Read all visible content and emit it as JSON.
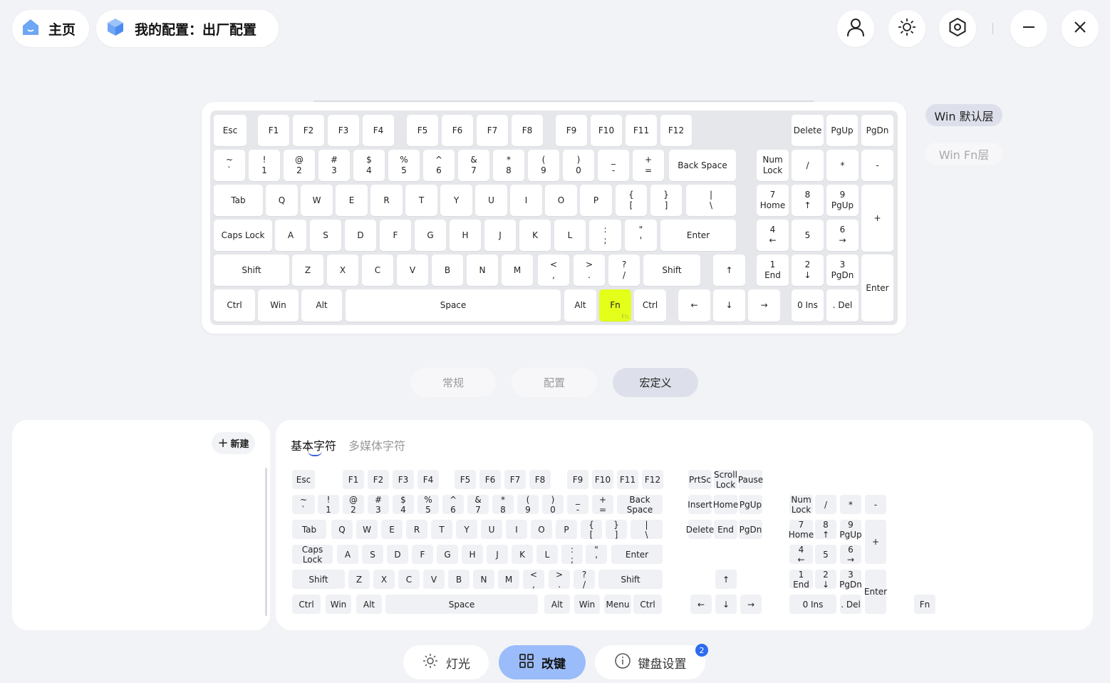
{
  "header": {
    "home_label": "主页",
    "config_label": "我的配置：出厂配置",
    "icons": [
      "user-icon",
      "sun-icon",
      "settings-hex-icon",
      "minimize-icon",
      "close-icon"
    ]
  },
  "layers": {
    "win_default": "Win 默认层",
    "win_fn": "Win Fn层"
  },
  "main_keyboard": {
    "fn_sublabel": "Fn",
    "rows": [
      [
        "Esc",
        "F1",
        "F2",
        "F3",
        "F4",
        "F5",
        "F6",
        "F7",
        "F8",
        "F9",
        "F10",
        "F11",
        "F12",
        "Delete",
        "PgUp",
        "PgDn"
      ],
      [
        "~|`",
        "!|1",
        "@|2",
        "#|3",
        "$|4",
        "%|5",
        "^|6",
        "&|7",
        "*|8",
        "(|9",
        ")|0",
        "_|-",
        "+|=",
        "Back Space",
        "Num|Lock",
        "/",
        "*",
        "-"
      ],
      [
        "Tab",
        "Q",
        "W",
        "E",
        "R",
        "T",
        "Y",
        "U",
        "I",
        "O",
        "P",
        "{|[",
        "}|]",
        "||\\",
        "7|Home",
        "8|↑",
        "9|PgUp",
        "+"
      ],
      [
        "Caps Lock",
        "A",
        "S",
        "D",
        "F",
        "G",
        "H",
        "J",
        "K",
        "L",
        ":|;",
        "\"|'",
        "Enter",
        "4|←",
        "5",
        "6|→"
      ],
      [
        "Shift",
        "Z",
        "X",
        "C",
        "V",
        "B",
        "N",
        "M",
        "<|,",
        ">|.",
        "?|/",
        "Shift",
        "↑",
        "1|End",
        "2|↓",
        "3|PgDn",
        "Enter"
      ],
      [
        "Ctrl",
        "Win",
        "Alt",
        "Space",
        "Alt",
        "Fn",
        "Ctrl",
        "←",
        "↓",
        "→",
        "0 Ins",
        ". Del"
      ]
    ]
  },
  "tabs": [
    "常规",
    "配置",
    "宏定义"
  ],
  "macro_panel": {
    "new_label": "新建"
  },
  "char_tabs": {
    "basic": "基本字符",
    "media": "多媒体字符"
  },
  "select_keyboard": {
    "rows": [
      [
        "Esc",
        "F1",
        "F2",
        "F3",
        "F4",
        "F5",
        "F6",
        "F7",
        "F8",
        "F9",
        "F10",
        "F11",
        "F12",
        "PrtSc",
        "Scroll|Lock",
        "Pause"
      ],
      [
        "~|`",
        "!|1",
        "@|2",
        "#|3",
        "$|4",
        "%|5",
        "^|6",
        "&|7",
        "*|8",
        "(|9",
        ")|0",
        "_|-",
        "+|=",
        "Back Space",
        "Insert",
        "Home",
        "PgUp",
        "Num|Lock",
        "/",
        "*",
        "-"
      ],
      [
        "Tab",
        "Q",
        "W",
        "E",
        "R",
        "T",
        "Y",
        "U",
        "I",
        "O",
        "P",
        "{|[",
        "}|]",
        "||\\",
        "Delete",
        "End",
        "PgDn",
        "7|Home",
        "8|↑",
        "9|PgUp",
        "+"
      ],
      [
        "Caps Lock",
        "A",
        "S",
        "D",
        "F",
        "G",
        "H",
        "J",
        "K",
        "L",
        ":|;",
        "\"|'",
        "Enter",
        "4|←",
        "5",
        "6|→"
      ],
      [
        "Shift",
        "Z",
        "X",
        "C",
        "V",
        "B",
        "N",
        "M",
        "<|,",
        ">|.",
        "?|/",
        "Shift",
        "↑",
        "1|End",
        "2|↓",
        "3|PgDn",
        "Enter"
      ],
      [
        "Ctrl",
        "Win",
        "Alt",
        "Space",
        "Alt",
        "Win",
        "Menu",
        "Ctrl",
        "←",
        "↓",
        "→",
        "0 Ins",
        ". Del",
        "Fn"
      ]
    ]
  },
  "bottom_nav": {
    "light": "灯光",
    "remap": "改键",
    "settings": "键盘设置",
    "badge": "2"
  },
  "colors": {
    "accent": "#9bbcfb",
    "fn_highlight": "#e3ff1a",
    "badge": "#2d6bf0"
  }
}
